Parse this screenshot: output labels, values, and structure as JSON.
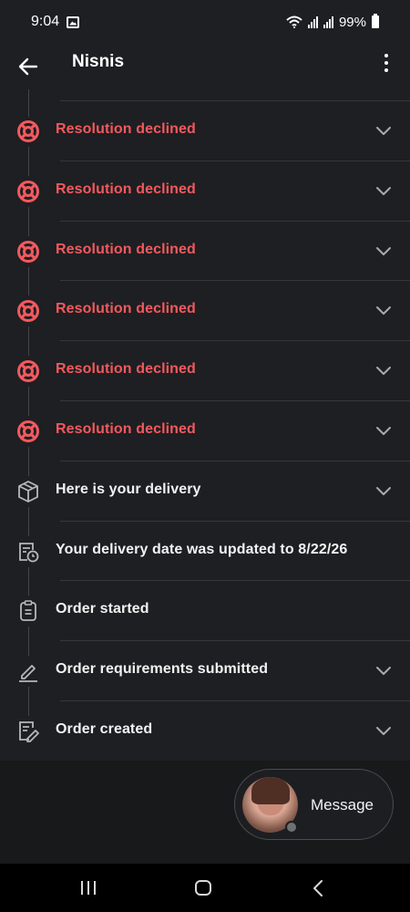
{
  "status_bar": {
    "time": "9:04",
    "battery": "99%"
  },
  "header": {
    "title": "Nisnis"
  },
  "timeline": {
    "items": [
      {
        "label": "Resolution declined",
        "icon": "lifebuoy-icon",
        "color": "#f2595e",
        "expandable": true
      },
      {
        "label": "Resolution declined",
        "icon": "lifebuoy-icon",
        "color": "#f2595e",
        "expandable": true
      },
      {
        "label": "Resolution declined",
        "icon": "lifebuoy-icon",
        "color": "#f2595e",
        "expandable": true
      },
      {
        "label": "Resolution declined",
        "icon": "lifebuoy-icon",
        "color": "#f2595e",
        "expandable": true
      },
      {
        "label": "Resolution declined",
        "icon": "lifebuoy-icon",
        "color": "#f2595e",
        "expandable": true
      },
      {
        "label": "Resolution declined",
        "icon": "lifebuoy-icon",
        "color": "#f2595e",
        "expandable": true
      },
      {
        "label": "Here is your delivery",
        "icon": "package-icon",
        "color": "#f2f2f2",
        "expandable": true
      },
      {
        "label": "Your delivery date was updated to 8/22/26",
        "icon": "calendar-clock-icon",
        "color": "#f2f2f2",
        "expandable": false
      },
      {
        "label": "Order started",
        "icon": "clipboard-icon",
        "color": "#f2f2f2",
        "expandable": false
      },
      {
        "label": "Order requirements submitted",
        "icon": "pencil-icon",
        "color": "#f2f2f2",
        "expandable": true
      },
      {
        "label": "Order created",
        "icon": "edit-document-icon",
        "color": "#f2f2f2",
        "expandable": true
      }
    ]
  },
  "message_button": {
    "label": "Message",
    "online_status": "offline"
  },
  "colors": {
    "background": "#1e1f22",
    "accent_red": "#f2595e",
    "divider": "#35373b"
  }
}
